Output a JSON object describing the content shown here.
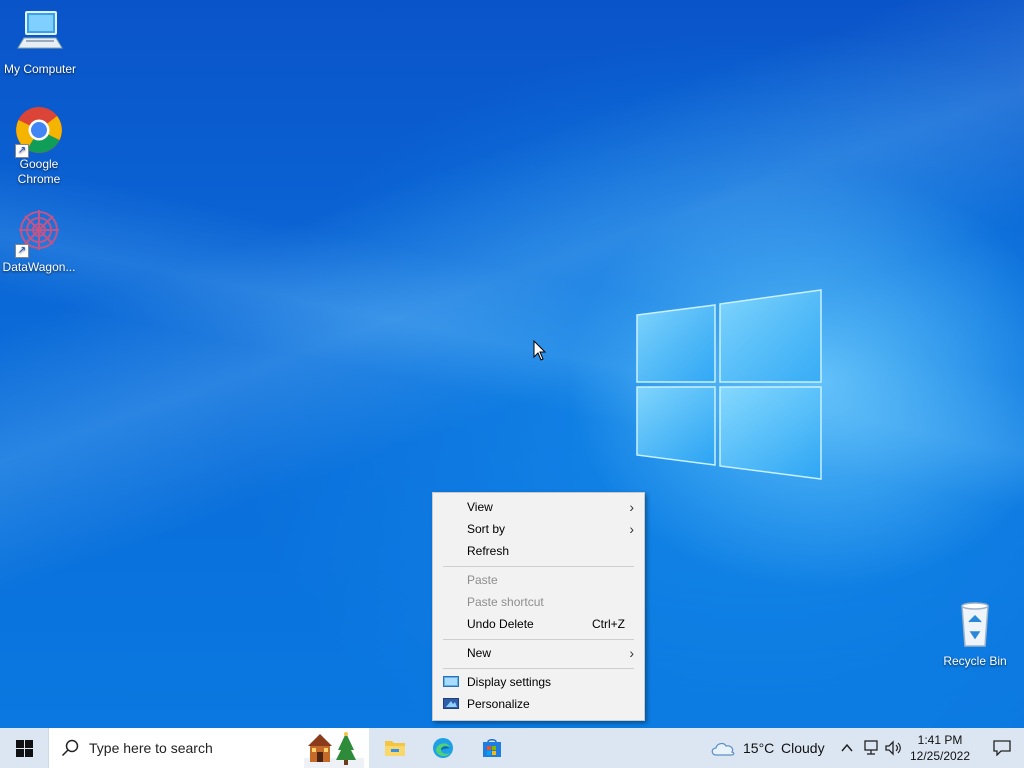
{
  "desktop": {
    "icons": [
      {
        "label": "My Computer"
      },
      {
        "label": "Google\nChrome"
      },
      {
        "label": "DataWagon..."
      },
      {
        "label": "Recycle Bin"
      }
    ]
  },
  "context_menu": {
    "items": [
      {
        "label": "View",
        "submenu": true
      },
      {
        "label": "Sort by",
        "submenu": true
      },
      {
        "label": "Refresh"
      },
      {
        "label": "Paste",
        "disabled": true
      },
      {
        "label": "Paste shortcut",
        "disabled": true
      },
      {
        "label": "Undo Delete",
        "shortcut": "Ctrl+Z"
      },
      {
        "label": "New",
        "submenu": true
      },
      {
        "label": "Display settings",
        "icon": "display-icon"
      },
      {
        "label": "Personalize",
        "icon": "personalize-icon"
      }
    ]
  },
  "taskbar": {
    "search_placeholder": "Type here to search",
    "pinned": [
      {
        "icon": "file-explorer-icon"
      },
      {
        "icon": "edge-icon"
      },
      {
        "icon": "store-icon"
      }
    ],
    "weather": {
      "temp": "15°C",
      "condition": "Cloudy"
    },
    "clock": {
      "time": "1:41 PM",
      "date": "12/25/2022"
    }
  }
}
